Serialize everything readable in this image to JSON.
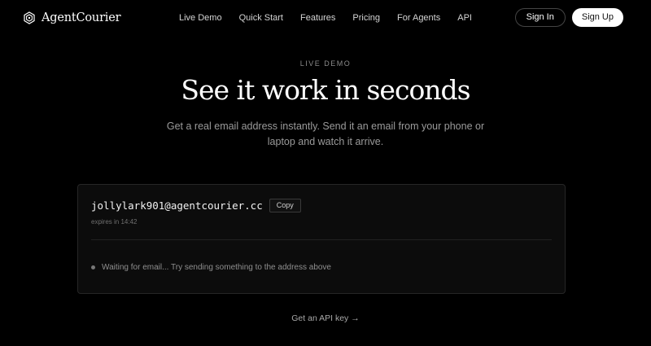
{
  "header": {
    "brand_name": "AgentCourier",
    "brand_icon": "hexagon-logo-icon",
    "nav": [
      "Live Demo",
      "Quick Start",
      "Features",
      "Pricing",
      "For Agents",
      "API"
    ],
    "sign_in_label": "Sign In",
    "sign_up_label": "Sign Up"
  },
  "hero": {
    "eyebrow": "LIVE DEMO",
    "headline": "See it work in seconds",
    "subtext": "Get a real email address instantly. Send it an email from your phone or laptop and watch it arrive."
  },
  "inbox": {
    "address": "jollylark901@agentcourier.cc",
    "copy_label": "Copy",
    "expires": "expires in 14:42",
    "status": "Waiting for email... Try sending something to the address above"
  },
  "cta": {
    "label": "Get an API key →"
  },
  "colors": {
    "background": "#000000",
    "card": "#0c0c0c",
    "text_primary": "#ffffff",
    "text_muted": "#9a9a9a"
  }
}
